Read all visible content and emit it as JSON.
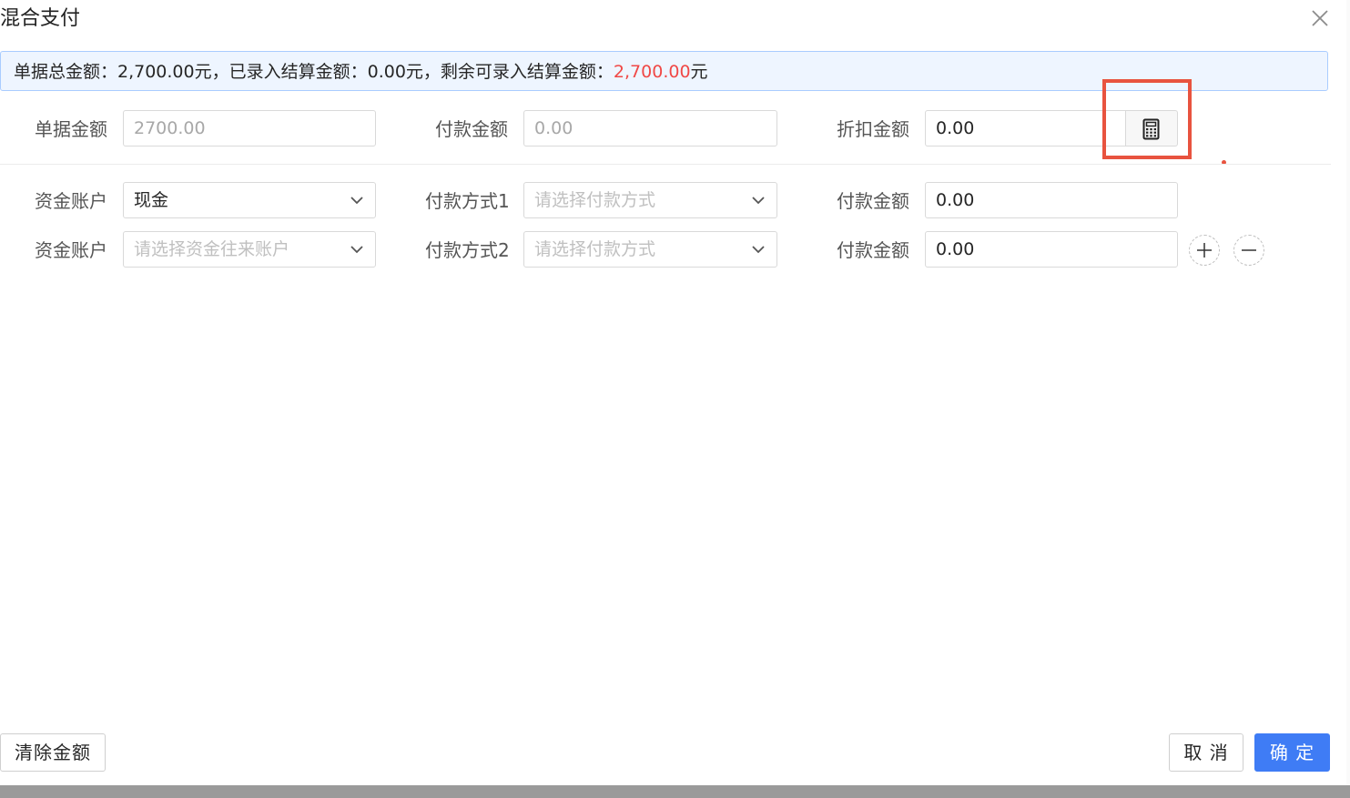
{
  "dialog": {
    "title": "混合支付",
    "close_icon": "close-icon"
  },
  "summary": {
    "text_before": "单据总金额：2,700.00元，已录入结算金额：0.00元，剩余可录入结算金额：",
    "remaining_amount": "2,700.00",
    "text_after": "元",
    "accent_color": "#f04846"
  },
  "row1": {
    "doc_amount_label": "单据金额",
    "doc_amount_value": "2700.00",
    "payment_amount_label": "付款金额",
    "payment_amount_value": "0.00",
    "discount_label": "折扣金额",
    "discount_value": "0.00",
    "calculator_icon": "calculator-icon"
  },
  "lines": [
    {
      "account_label": "资金账户",
      "account_value": "现金",
      "account_placeholder": "",
      "method_label": "付款方式1",
      "method_placeholder": "请选择付款方式",
      "amount_label": "付款金额",
      "amount_value": "0.00"
    },
    {
      "account_label": "资金账户",
      "account_value": "",
      "account_placeholder": "请选择资金往来账户",
      "method_label": "付款方式2",
      "method_placeholder": "请选择付款方式",
      "amount_label": "付款金额",
      "amount_value": "0.00"
    }
  ],
  "footer": {
    "clear_label": "清除金额",
    "cancel_label": "取 消",
    "confirm_label": "确 定"
  },
  "colors": {
    "primary": "#3f7cf5",
    "highlight": "#e8533f",
    "info_bg": "#eef5ff"
  }
}
